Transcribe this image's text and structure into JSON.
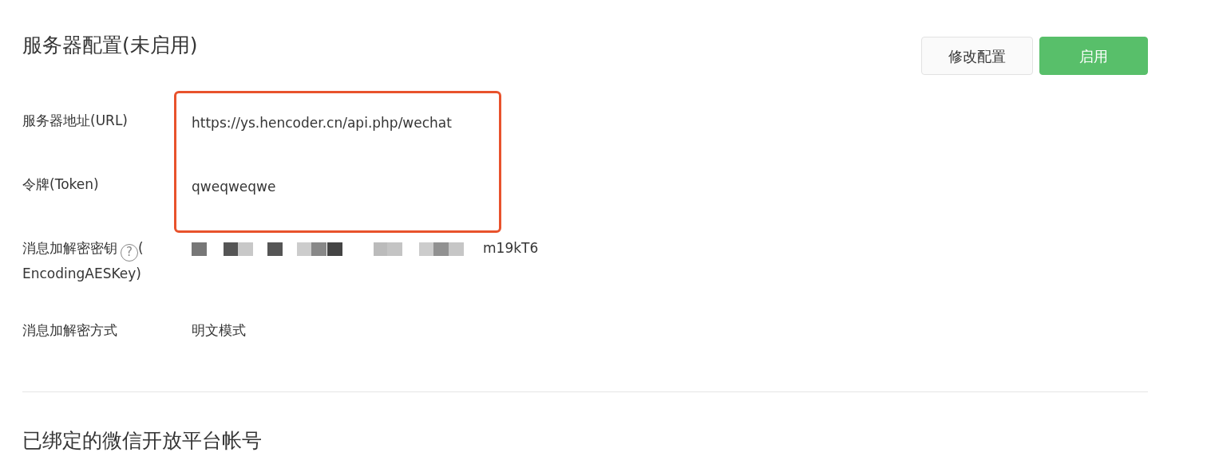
{
  "title": "服务器配置(未启用)",
  "buttons": [
    {
      "label": "修改配置",
      "kind": "secondary"
    },
    {
      "label": "启用",
      "kind": "primary"
    }
  ],
  "highlighted_fields": [
    {
      "label": "服务器地址(URL)",
      "value": "https://ys.hencoder.cn/api.php/wechat"
    },
    {
      "label": "令牌(Token)",
      "value": "qweqweqwe"
    }
  ],
  "key_field": {
    "label": "消息加解密密钥",
    "help": "?",
    "label_tail": [
      "(",
      "EncodingAESKey)"
    ],
    "value_visible": "m19kT6",
    "redacted": true
  },
  "mode_field": {
    "label": "消息加解密方式",
    "value": "明文模式"
  },
  "section_title": "已绑定的微信开放平台帐号"
}
